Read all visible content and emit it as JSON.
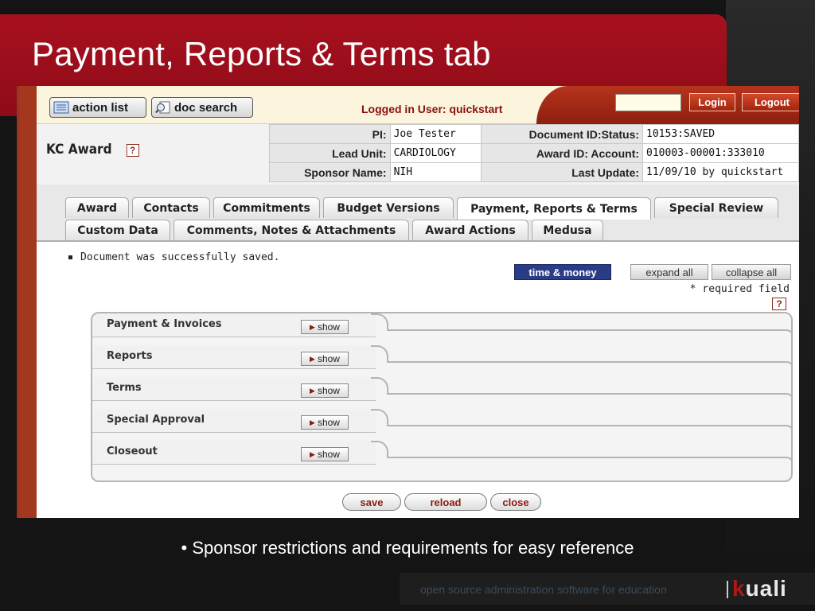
{
  "slide": {
    "title": "Payment, Reports & Terms tab",
    "caption": "• Sponsor restrictions and requirements for easy reference",
    "footer_text": "open source administration software for education",
    "logo_mark": "k",
    "logo_rest": "uali"
  },
  "portal": {
    "action_list_label": "action list",
    "doc_search_label": "doc search",
    "logged_in": "Logged in User: quickstart",
    "login_label": "Login",
    "logout_label": "Logout",
    "login_value": ""
  },
  "doc": {
    "title": "KC Award",
    "help": "?",
    "rows": [
      {
        "l1": "PI:",
        "v1": "Joe Tester",
        "l2": "Document ID:Status:",
        "v2": "10153:SAVED"
      },
      {
        "l1": "Lead Unit:",
        "v1": "CARDIOLOGY",
        "l2": "Award ID: Account:",
        "v2": "010003-00001:333010"
      },
      {
        "l1": "Sponsor Name:",
        "v1": "NIH",
        "l2": "Last Update:",
        "v2": "11/09/10 by quickstart"
      }
    ]
  },
  "tabs": {
    "row1": [
      "Award",
      "Contacts",
      "Commitments",
      "Budget Versions",
      "Payment, Reports & Terms",
      "Special Review"
    ],
    "row2": [
      "Custom Data",
      "Comments, Notes & Attachments",
      "Award Actions",
      "Medusa"
    ],
    "active": "Payment, Reports & Terms"
  },
  "content": {
    "message": "Document was successfully saved.",
    "time_money": "time & money",
    "expand_all": "expand all",
    "collapse_all": "collapse all",
    "required": "* required field",
    "sections": [
      "Payment & Invoices",
      "Reports",
      "Terms",
      "Special Approval",
      "Closeout"
    ],
    "show_label": "show",
    "save": "save",
    "reload": "reload",
    "close": "close"
  },
  "colors": {
    "brand_red": "#a8101e",
    "time_money_blue": "#2b3c86"
  }
}
